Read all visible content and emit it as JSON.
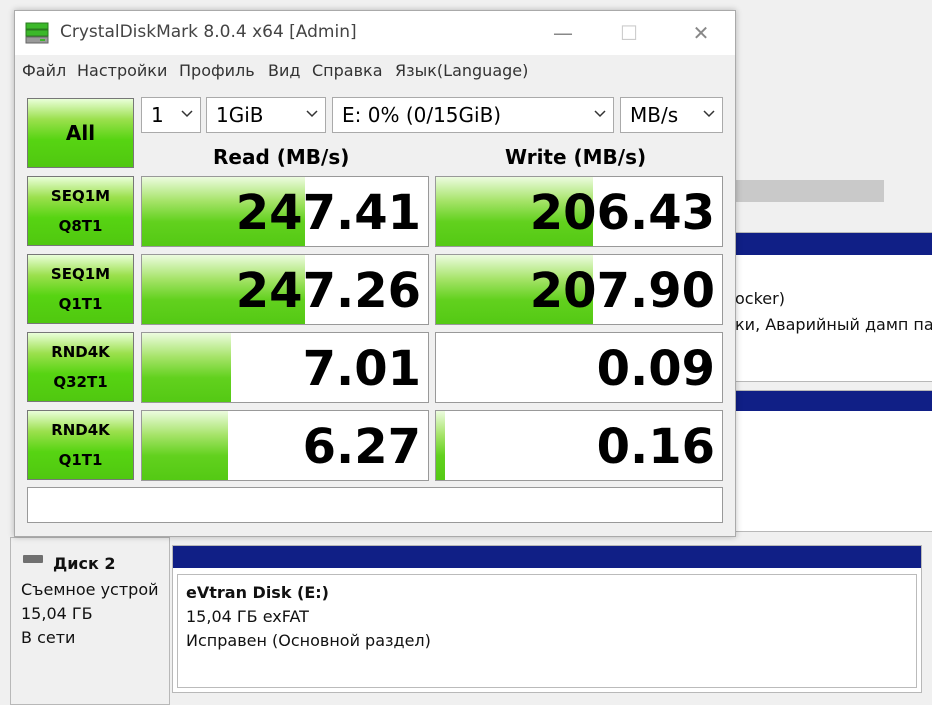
{
  "window": {
    "title": "CrystalDiskMark 8.0.4 x64 [Admin]",
    "minimize_glyph": "—",
    "maximize_glyph": "☐",
    "close_glyph": "✕"
  },
  "menu": [
    "Файл",
    "Настройки",
    "Профиль",
    "Вид",
    "Справка",
    "Язык(Language)"
  ],
  "controls": {
    "all_label": "All",
    "count": "1",
    "size": "1GiB",
    "drive": "E: 0% (0/15GiB)",
    "unit": "MB/s"
  },
  "headers": {
    "read": "Read (MB/s)",
    "write": "Write (MB/s)"
  },
  "tests": [
    {
      "line1": "SEQ1M",
      "line2": "Q8T1",
      "read": "247.41",
      "write": "206.43",
      "read_fill": 0.57,
      "write_fill": 0.55
    },
    {
      "line1": "SEQ1M",
      "line2": "Q1T1",
      "read": "247.26",
      "write": "207.90",
      "read_fill": 0.57,
      "write_fill": 0.55
    },
    {
      "line1": "RND4K",
      "line2": "Q32T1",
      "read": "7.01",
      "write": "0.09",
      "read_fill": 0.31,
      "write_fill": 0.0
    },
    {
      "line1": "RND4K",
      "line2": "Q1T1",
      "read": "6.27",
      "write": "0.16",
      "read_fill": 0.3,
      "write_fill": 0.03
    }
  ],
  "status_text": "",
  "background": {
    "partial_line1": "ocker)",
    "partial_line2": "ки, Аварийный дамп пам",
    "disk": {
      "name": "Диск 2",
      "type": "Съемное устрой",
      "size": "15,04 ГБ",
      "state": "В сети"
    },
    "volume": {
      "name": "eVtran Disk  (E:)",
      "fs": "15,04 ГБ exFAT",
      "status": "Исправен (Основной раздел)"
    }
  },
  "colors": {
    "green": "#57d412",
    "volume_bar": "#101f86"
  }
}
